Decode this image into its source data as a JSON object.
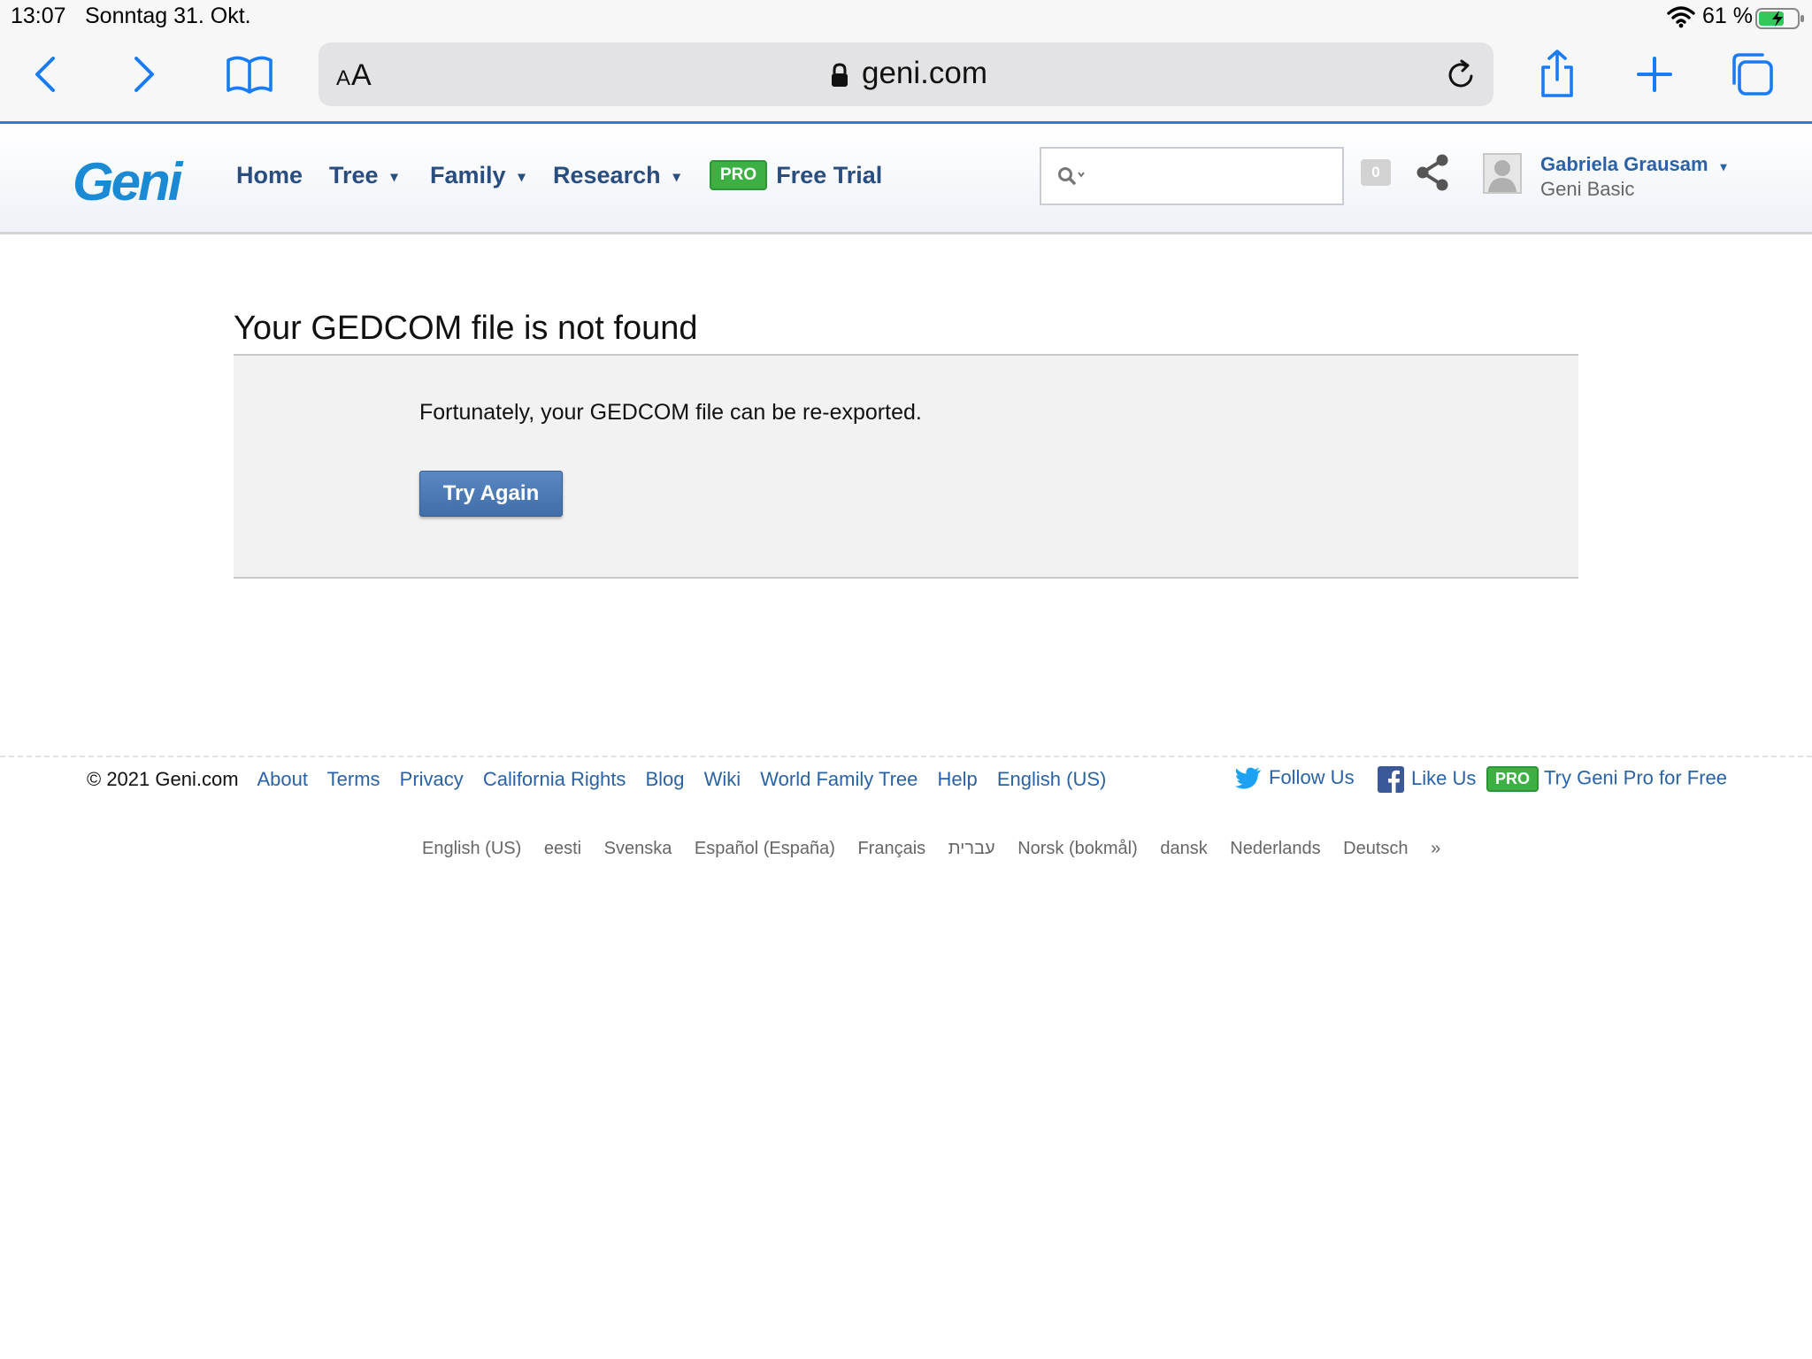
{
  "status_bar": {
    "time": "13:07",
    "date": "Sonntag 31. Okt.",
    "battery": "61 %"
  },
  "browser": {
    "text_size_big": "A",
    "text_size_small": "A",
    "url": "geni.com"
  },
  "header": {
    "logo": "Geni",
    "nav": {
      "home": "Home",
      "tree": "Tree",
      "family": "Family",
      "research": "Research"
    },
    "caret": "▾",
    "pro_badge": "PRO",
    "free_trial": "Free Trial",
    "notifications": "0",
    "user_name": "Gabriela Grausam",
    "user_plan": "Geni Basic"
  },
  "main": {
    "title": "Your GEDCOM file is not found",
    "message": "Fortunately, your GEDCOM file can be re-exported.",
    "button": "Try Again"
  },
  "footer": {
    "copyright": "© 2021 Geni.com",
    "links": [
      "About",
      "Terms",
      "Privacy",
      "California Rights",
      "Blog",
      "Wiki",
      "World Family Tree",
      "Help",
      "English (US)"
    ],
    "follow_us": "Follow Us",
    "like_us": "Like Us",
    "pro_badge": "PRO",
    "try_pro": "Try Geni Pro for Free",
    "languages": [
      "English (US)",
      "eesti",
      "Svenska",
      "Español (España)",
      "Français",
      "עברית",
      "Norsk (bokmål)",
      "dansk",
      "Nederlands",
      "Deutsch",
      "»"
    ]
  },
  "colors": {
    "ios_blue": "#1a7cf2",
    "geni_navy": "#2a4d7f",
    "link_blue": "#2a62a6",
    "pro_green": "#3cb043"
  }
}
